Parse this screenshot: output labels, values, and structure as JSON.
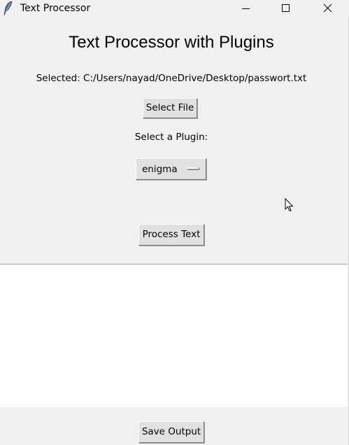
{
  "window": {
    "title": "Text Processor",
    "icons": {
      "app": "feather-icon",
      "minimize": "minimize-icon",
      "maximize": "maximize-icon",
      "close": "close-icon"
    }
  },
  "main": {
    "heading": "Text Processor with Plugins",
    "selected_file_label": "Selected: C:/Users/nayad/OneDrive/Desktop/passwort.txt",
    "select_file_button": "Select File",
    "plugin_label": "Select a Plugin:",
    "plugin_selected": "enigma",
    "process_button": "Process Text",
    "output_text": "",
    "save_button": "Save Output"
  },
  "colors": {
    "window_bg": "#f0f0f0",
    "button_bg": "#e1e1e1",
    "output_bg": "#ffffff"
  }
}
